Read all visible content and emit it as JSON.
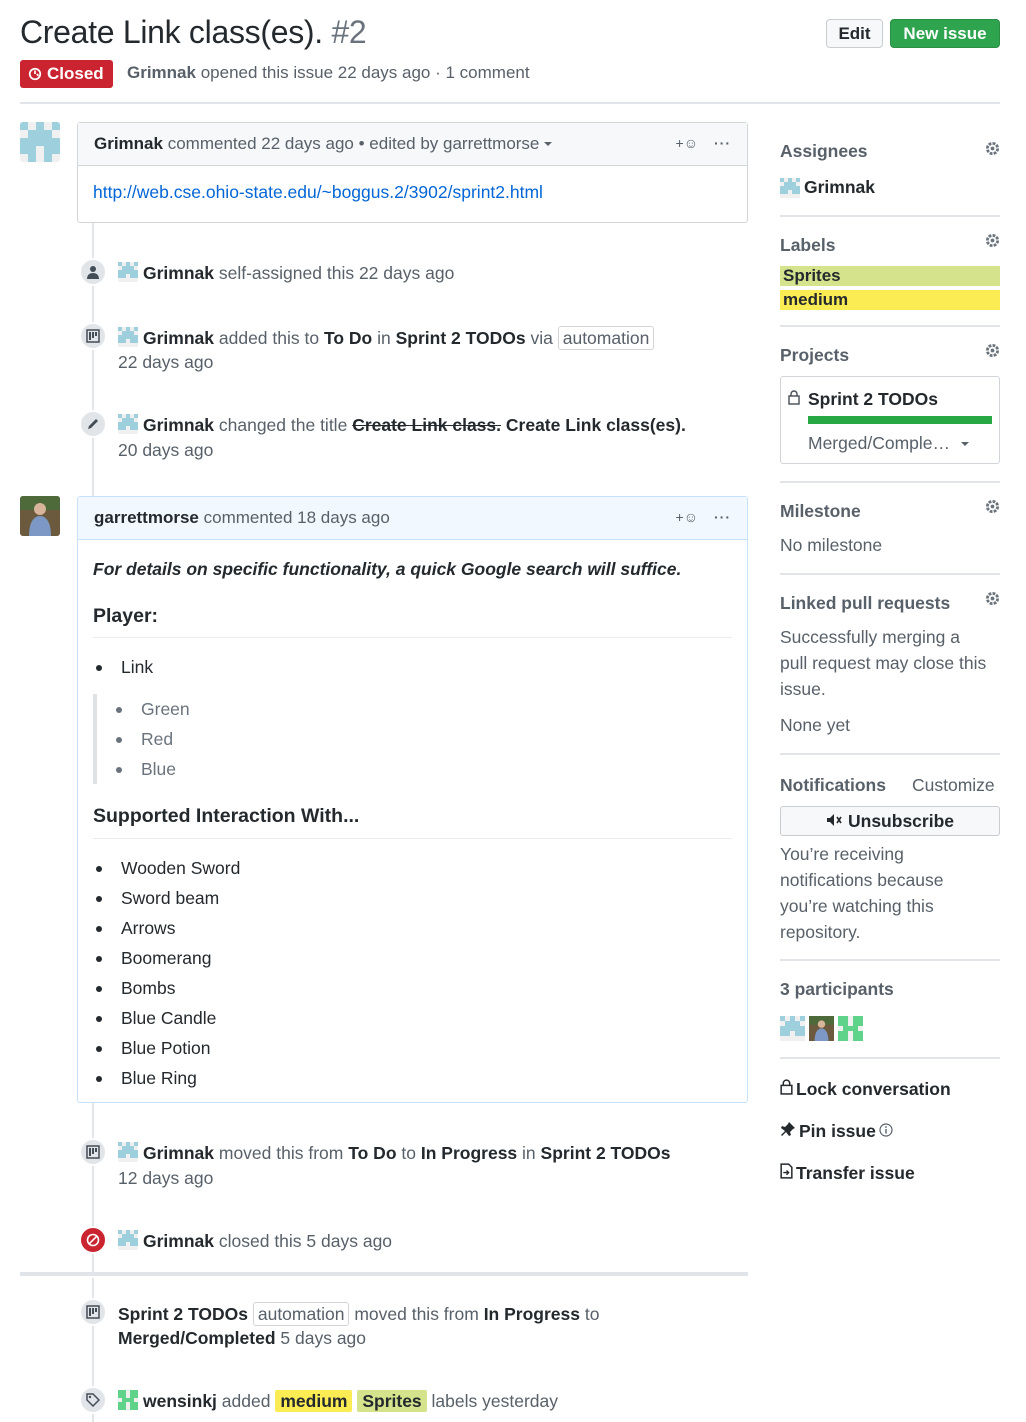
{
  "issue": {
    "title": "Create Link class(es).",
    "number": "#2",
    "state": "Closed",
    "author": "Grimnak",
    "opened_text": "opened this issue 22 days ago · 1 comment",
    "edit_label": "Edit",
    "new_issue_label": "New issue"
  },
  "first_comment": {
    "author": "Grimnak",
    "meta": "commented 22 days ago",
    "edited": "• edited by garrettmorse",
    "link": "http://web.cse.ohio-state.edu/~boggus.2/3902/sprint2.html",
    "dots": "···"
  },
  "events": {
    "assign": {
      "actor": "Grimnak",
      "text": "self-assigned this 22 days ago"
    },
    "added": {
      "actor": "Grimnak",
      "t1": "added this to",
      "column": "To Do",
      "t2": "in",
      "project": "Sprint 2 TODOs",
      "t3": "via",
      "pill": "automation",
      "time": "22 days ago"
    },
    "rename": {
      "actor": "Grimnak",
      "t1": "changed the title",
      "old": "Create Link class.",
      "new": "Create Link class(es).",
      "time": "20 days ago"
    },
    "moved": {
      "actor": "Grimnak",
      "t1": "moved this from",
      "from": "To Do",
      "t2": "to",
      "to": "In Progress",
      "t3": "in",
      "project": "Sprint 2 TODOs",
      "time": "12 days ago"
    },
    "closed": {
      "actor": "Grimnak",
      "text": "closed this 5 days ago"
    },
    "auto_move": {
      "project": "Sprint 2 TODOs",
      "pill": "automation",
      "t1": "moved this from",
      "from": "In Progress",
      "t2": "to",
      "to": "Merged/Completed",
      "time": "5 days ago"
    },
    "labels": {
      "actor": "wensinkj",
      "t1": "added",
      "label1": "medium",
      "label2": "Sprites",
      "t2": "labels yesterday"
    }
  },
  "second_comment": {
    "author": "garrettmorse",
    "meta": "commented 18 days ago",
    "dots": "···",
    "intro": "For details on specific functionality, a quick Google search will suffice.",
    "heading1": "Player:",
    "player": [
      "Link"
    ],
    "variants": [
      "Green",
      "Red",
      "Blue"
    ],
    "heading2": "Supported Interaction With...",
    "interactions": [
      "Wooden Sword",
      "Sword beam",
      "Arrows",
      "Boomerang",
      "Bombs",
      "Blue Candle",
      "Blue Potion",
      "Blue Ring"
    ]
  },
  "sidebar": {
    "assignees_title": "Assignees",
    "assignee": "Grimnak",
    "labels_title": "Labels",
    "labels": [
      {
        "name": "Sprites",
        "color": "#d4e38c"
      },
      {
        "name": "medium",
        "color": "#fbec54"
      }
    ],
    "projects_title": "Projects",
    "project_name": "Sprint 2 TODOs",
    "project_column": "Merged/Comple…",
    "project_progress": 1.0,
    "milestone_title": "Milestone",
    "milestone_value": "No milestone",
    "linked_title": "Linked pull requests",
    "linked_desc": "Successfully merging a pull request may close this issue.",
    "linked_none": "None yet",
    "notifications_title": "Notifications",
    "customize": "Customize",
    "unsubscribe": "Unsubscribe",
    "notif_reason": "You’re receiving notifications because you’re watching this repository.",
    "participants": "3 participants",
    "lock": "Lock conversation",
    "pin": "Pin issue",
    "transfer": "Transfer issue"
  },
  "colors": {
    "closed_red": "#cb2431",
    "green_btn": "#2ea44f",
    "link_blue": "#0366d6"
  }
}
